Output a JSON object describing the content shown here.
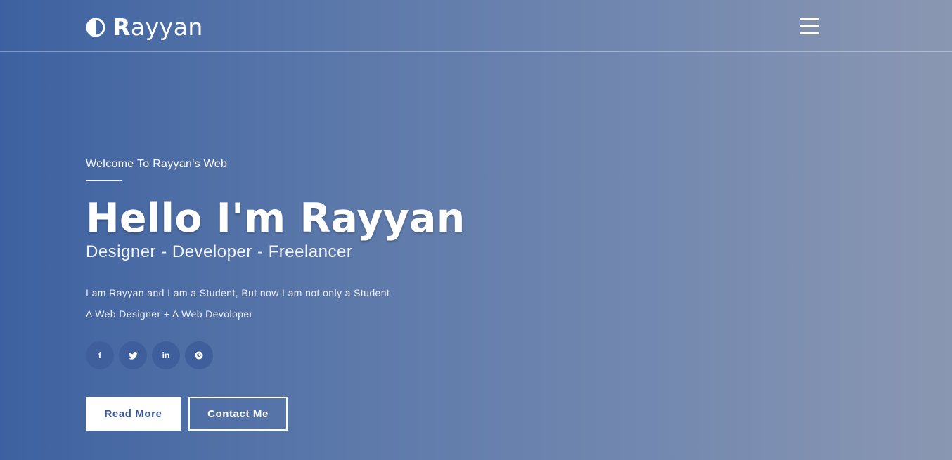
{
  "brand": {
    "initial": "R",
    "rest": "ayyan",
    "icon": "half-circle-icon"
  },
  "nav": {
    "menu_icon": "hamburger-menu-icon"
  },
  "hero": {
    "welcome": "Welcome To Rayyan's Web",
    "title": "Hello I'm Rayyan",
    "subtitle": "Designer - Developer - Freelancer",
    "desc_line1": "I am Rayyan and I am a Student, But now I am not only a Student",
    "desc_line2": "A Web Designer + A Web Devoloper"
  },
  "socials": [
    {
      "icon": "facebook-icon",
      "glyph": "f"
    },
    {
      "icon": "twitter-icon",
      "glyph": ""
    },
    {
      "icon": "linkedin-icon",
      "glyph": "in"
    },
    {
      "icon": "pinterest-icon",
      "glyph": ""
    }
  ],
  "buttons": {
    "read_more": "Read More",
    "contact_me": "Contact Me"
  },
  "colors": {
    "gradient_start": "#3d61a0",
    "gradient_end": "#8a97b2",
    "social_bg": "#3f5f9c",
    "primary_text": "#3a5a96"
  }
}
